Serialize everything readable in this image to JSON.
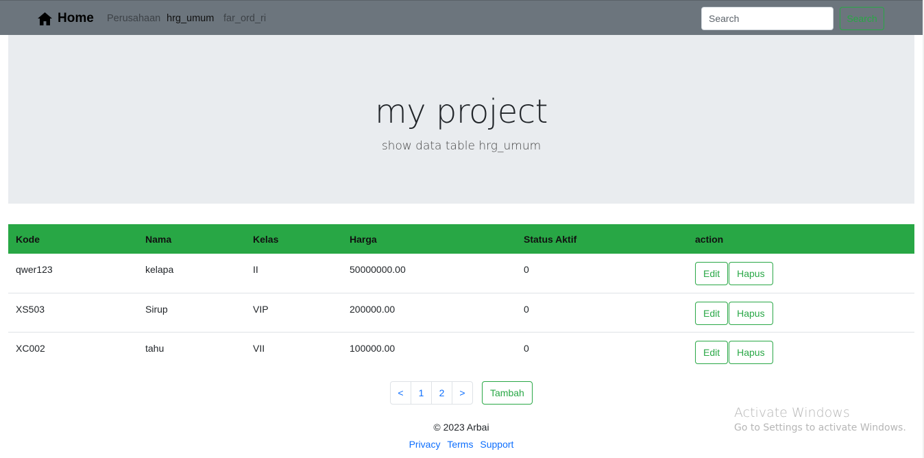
{
  "navbar": {
    "brand": "Home",
    "links": [
      "Perusahaan",
      "hrg_umum",
      "far_ord_ri"
    ],
    "search_placeholder": "Search",
    "search_button": "Search"
  },
  "jumbotron": {
    "title": "my project",
    "subtitle": "show data table hrg_umum"
  },
  "table": {
    "headers": [
      "Kode",
      "Nama",
      "Kelas",
      "Harga",
      "Status Aktif",
      "action"
    ],
    "rows": [
      {
        "kode": "qwer123",
        "nama": "kelapa",
        "kelas": "II",
        "harga": "50000000.00",
        "status": "0"
      },
      {
        "kode": "XS503",
        "nama": "Sirup",
        "kelas": "VIP",
        "harga": "200000.00",
        "status": "0"
      },
      {
        "kode": "XC002",
        "nama": "tahu",
        "kelas": "VII",
        "harga": "100000.00",
        "status": "0"
      }
    ],
    "edit_label": "Edit",
    "delete_label": "Hapus"
  },
  "pagination": {
    "prev": "<",
    "pages": [
      "1",
      "2"
    ],
    "next": ">",
    "add_label": "Tambah"
  },
  "footer": {
    "copyright": "© 2023 Arbai",
    "links": [
      "Privacy",
      "Terms",
      "Support"
    ]
  },
  "watermark": {
    "title": "Activate Windows",
    "subtitle": "Go to Settings to activate Windows."
  },
  "colors": {
    "navbar": "#6c757d",
    "accent_green": "#28a745",
    "jumbotron": "#e9ecef",
    "link_blue": "#0d6efd"
  },
  "icons": {
    "brand": "home-icon"
  }
}
